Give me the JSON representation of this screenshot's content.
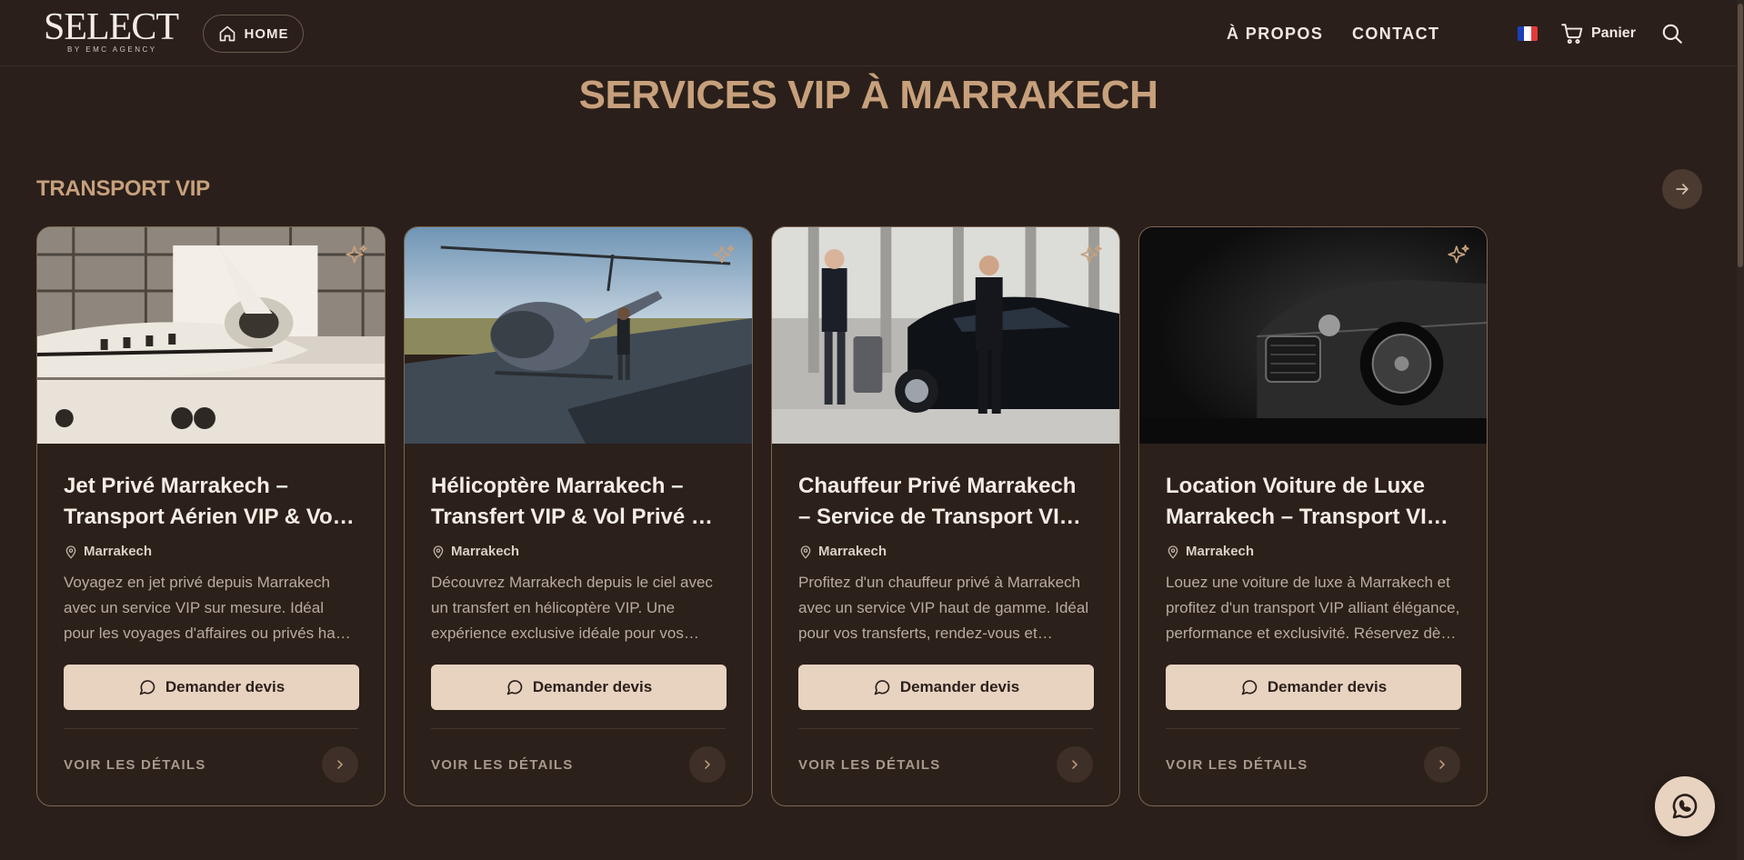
{
  "header": {
    "logo_text": "SELECT",
    "logo_subtext": "BY EMC AGENCY",
    "home_label": "HOME",
    "nav": [
      {
        "label": "À PROPOS"
      },
      {
        "label": "CONTACT"
      }
    ],
    "language_flag": "fr-flag-icon",
    "cart_label": "Panier"
  },
  "main": {
    "page_title": "SERVICES VIP À MARRAKECH",
    "section_title": "TRANSPORT VIP"
  },
  "cards": [
    {
      "image": "private-jet-photo",
      "title": "Jet Privé Marrakech – Transport Aérien VIP & Vol Privé",
      "location": "Marrakech",
      "description": "Voyagez en jet privé depuis Marrakech avec un service VIP sur mesure. Idéal pour les voyages d'affaires ou privés haut de gamme.",
      "button_label": "Demander devis",
      "details_label": "VOIR LES DÉTAILS"
    },
    {
      "image": "helicopter-photo",
      "title": "Hélicoptère Marrakech – Transfert VIP & Vol Privé de luxe",
      "location": "Marrakech",
      "description": "Découvrez Marrakech depuis le ciel avec un transfert en hélicoptère VIP. Une expérience exclusive idéale pour vos événements.",
      "button_label": "Demander devis",
      "details_label": "VOIR LES DÉTAILS"
    },
    {
      "image": "chauffeur-photo",
      "title": "Chauffeur Privé Marrakech – Service de Transport VIP sur mesure",
      "location": "Marrakech",
      "description": "Profitez d'un chauffeur privé à Marrakech avec un service VIP haut de gamme. Idéal pour vos transferts, rendez-vous et événements.",
      "button_label": "Demander devis",
      "details_label": "VOIR LES DÉTAILS"
    },
    {
      "image": "luxury-car-photo",
      "title": "Location Voiture de Luxe Marrakech – Transport VIP Premium",
      "location": "Marrakech",
      "description": "Louez une voiture de luxe à Marrakech et profitez d'un transport VIP alliant élégance, performance et exclusivité. Réservez dès maintenant.",
      "button_label": "Demander devis",
      "details_label": "VOIR LES DÉTAILS"
    }
  ],
  "colors": {
    "background": "#2a1f1a",
    "accent_gold": "#c7a07c",
    "button_beige": "#e8d3c1"
  }
}
